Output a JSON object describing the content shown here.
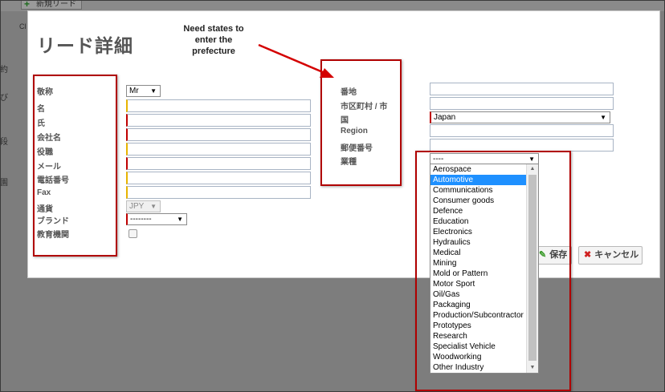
{
  "background": {
    "new_lead_button": "新規リード",
    "side_texts": [
      "Cl",
      "約",
      "び",
      "段",
      "園"
    ]
  },
  "modal": {
    "title": "リード詳細",
    "annotation_note": "Need states to enter the prefecture",
    "left_form": {
      "salutation": {
        "label": "敬称",
        "value": "Mr"
      },
      "first_name": {
        "label": "名"
      },
      "last_name": {
        "label": "氏"
      },
      "company": {
        "label": "会社名"
      },
      "title": {
        "label": "役職"
      },
      "email": {
        "label": "メール"
      },
      "phone": {
        "label": "電話番号"
      },
      "fax": {
        "label": "Fax"
      },
      "currency": {
        "label": "通貨",
        "value": "JPY"
      },
      "brand": {
        "label": "ブランド",
        "value": "--------"
      },
      "education": {
        "label": "教育機関"
      }
    },
    "right_form": {
      "street": {
        "label": "番地"
      },
      "city": {
        "label": "市区町村 / 市"
      },
      "country": {
        "label": "国",
        "value": "Japan"
      },
      "region": {
        "label": "Region"
      },
      "postal_code": {
        "label": "郵便番号"
      },
      "industry": {
        "label": "業種",
        "value": "----"
      }
    },
    "buttons": {
      "save": "保存",
      "cancel": "キャンセル"
    }
  },
  "industry_options": [
    "Aerospace",
    "Automotive",
    "Communications",
    "Consumer goods",
    "Defence",
    "Education",
    "Electronics",
    "Hydraulics",
    "Medical",
    "Mining",
    "Mold or Pattern",
    "Motor Sport",
    "Oil/Gas",
    "Packaging",
    "Production/Subcontractor",
    "Prototypes",
    "Research",
    "Specialist Vehicle",
    "Woodworking",
    "Other Industry"
  ],
  "industry_highlighted": "Automotive",
  "colors": {
    "required_red": "#c00000",
    "required_yellow": "#e8b400",
    "annotation_red": "#b00000",
    "highlight_blue": "#1e90ff",
    "save_icon_green": "#3a9a2a",
    "cancel_icon_red": "#d02020"
  }
}
